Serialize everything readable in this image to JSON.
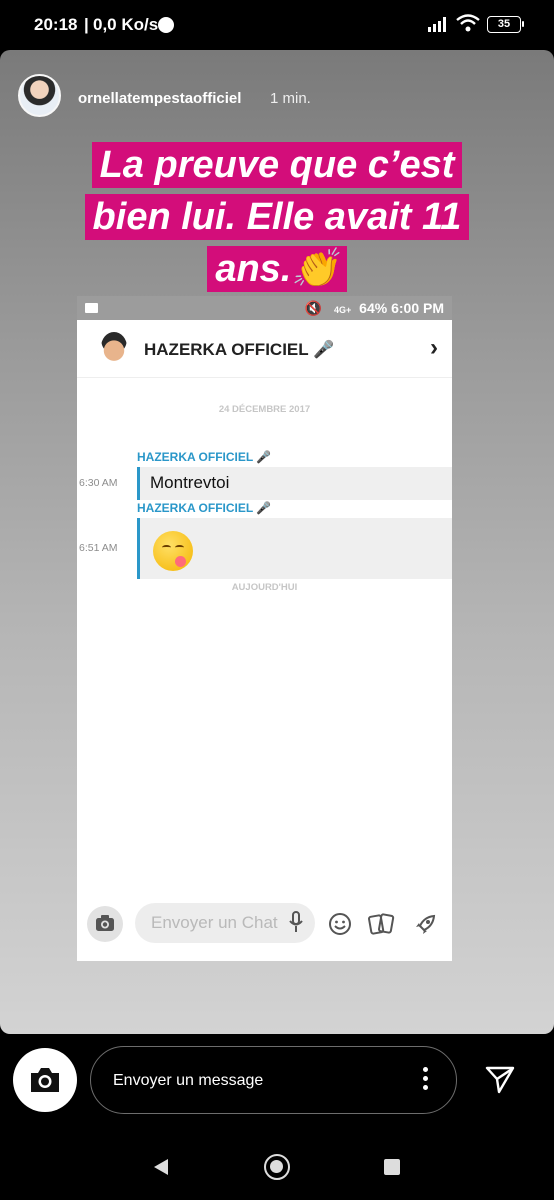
{
  "status_bar": {
    "time": "20:18",
    "separator": "|",
    "network_speed": "0,0 Ko/s",
    "battery": "35",
    "icons": [
      "messenger-icon",
      "signal-icon",
      "wifi-icon",
      "battery-icon"
    ]
  },
  "story": {
    "username": "ornellatempestaofficiel",
    "time_ago": "1 min.",
    "caption_lines": [
      "La preuve que c’est",
      "bien lui. Elle avait 11",
      "ans.👏"
    ],
    "caption_color": "#d30d7a"
  },
  "screenshot": {
    "status": {
      "mute": "🔇",
      "net": "4G+",
      "battery": "64%",
      "time": "6:00 PM"
    },
    "chat_title": "HAZERKA OFFICIEL 🎤",
    "chevron": "›",
    "date_separator": "24 DÉCEMBRE 2017",
    "messages": [
      {
        "sender": "HAZERKA OFFICIEL 🎤",
        "time": "6:30 AM",
        "text": "Montrevtoi"
      },
      {
        "sender": "HAZERKA OFFICIEL 🎤",
        "time": "6:51 AM",
        "emoji": "face-savoring-food-icon"
      }
    ],
    "today_separator": "AUJOURD'HUI",
    "composer_placeholder": "Envoyer un Chat",
    "accent_color": "#2a97c9"
  },
  "reply_bar": {
    "placeholder": "Envoyer un message"
  }
}
